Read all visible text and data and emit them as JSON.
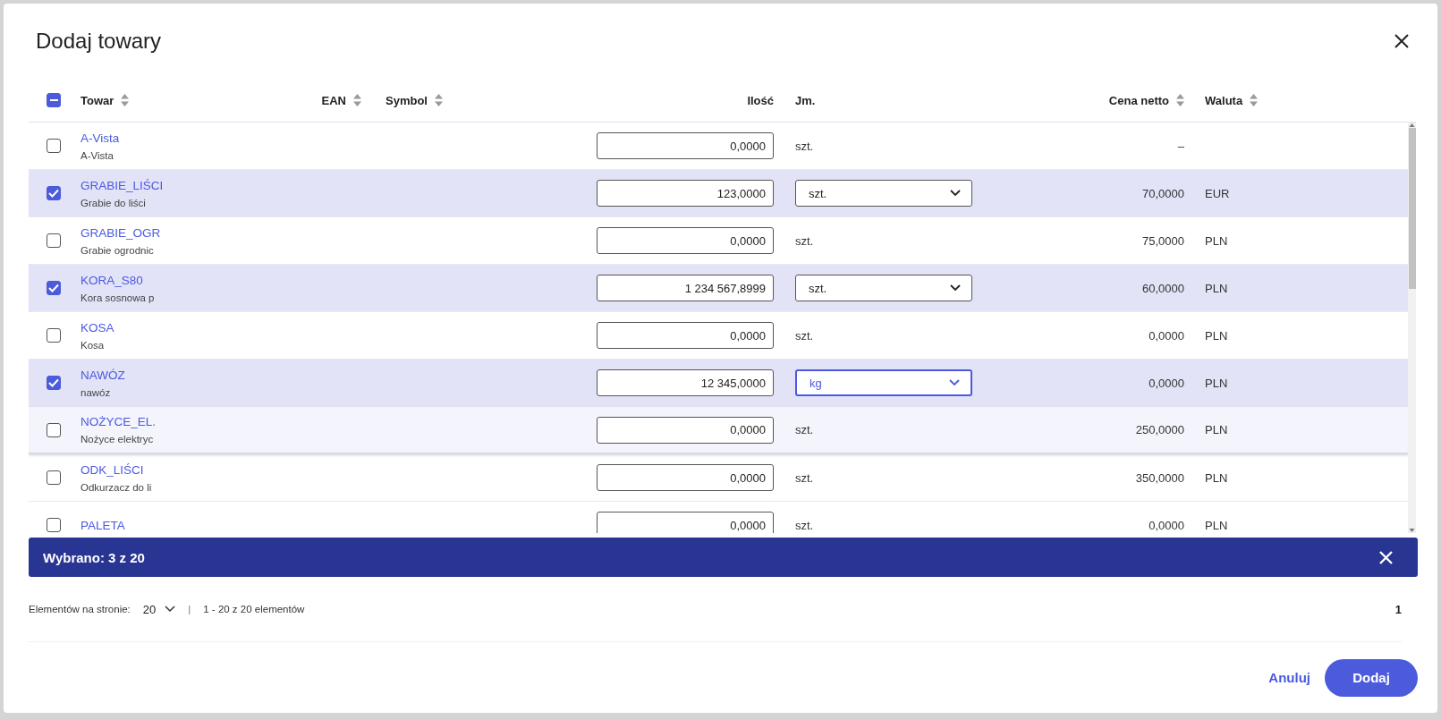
{
  "dialog": {
    "title": "Dodaj towary"
  },
  "table": {
    "select_all": {
      "indeterminate": true
    },
    "columns": [
      {
        "label": "Towar",
        "sortable": true
      },
      {
        "label": "EAN",
        "sortable": true
      },
      {
        "label": "Symbol",
        "sortable": true
      },
      {
        "label": "Ilość",
        "sortable": false
      },
      {
        "label": "Jm.",
        "sortable": false
      },
      {
        "label": "Cena netto",
        "sortable": true
      },
      {
        "label": "Waluta",
        "sortable": true
      }
    ],
    "rows": [
      {
        "name": "A-Vista",
        "description": "A-Vista",
        "selected": false,
        "hovered": false,
        "quantity": "0,0000",
        "unit": {
          "kind": "text",
          "value": "szt."
        },
        "price": "–"
      },
      {
        "name": "GRABIE_LIŚCI",
        "description": "Grabie do liści",
        "selected": true,
        "hovered": false,
        "quantity": "123,0000",
        "unit": {
          "kind": "dropdown",
          "value": "szt.",
          "focused": false
        },
        "price": "70,0000",
        "currency": "EUR"
      },
      {
        "name": "GRABIE_OGR",
        "description": "Grabie ogrodnic",
        "selected": false,
        "hovered": false,
        "quantity": "0,0000",
        "unit": {
          "kind": "text",
          "value": "szt."
        },
        "price": "75,0000",
        "currency": "PLN"
      },
      {
        "name": "KORA_S80",
        "description": "Kora sosnowa p",
        "selected": true,
        "hovered": false,
        "quantity": "1 234 567,8999",
        "unit": {
          "kind": "dropdown",
          "value": "szt.",
          "focused": false
        },
        "price": "60,0000",
        "currency": "PLN"
      },
      {
        "name": "KOSA",
        "description": "Kosa",
        "selected": false,
        "hovered": false,
        "quantity": "0,0000",
        "unit": {
          "kind": "text",
          "value": "szt."
        },
        "price": "0,0000",
        "currency": "PLN"
      },
      {
        "name": "NAWÓZ",
        "description": "nawóz",
        "selected": true,
        "hovered": false,
        "quantity": "12 345,0000",
        "unit": {
          "kind": "dropdown",
          "value": "kg",
          "focused": true
        },
        "price": "0,0000",
        "currency": "PLN"
      },
      {
        "name": "NOŻYCE_EL.",
        "description": "Nożyce elektryc",
        "selected": false,
        "hovered": true,
        "quantity": "0,0000",
        "unit": {
          "kind": "text",
          "value": "szt."
        },
        "price": "250,0000",
        "currency": "PLN"
      },
      {
        "name": "ODK_LIŚCI",
        "description": "Odkurzacz do li",
        "selected": false,
        "hovered": false,
        "quantity": "0,0000",
        "unit": {
          "kind": "text",
          "value": "szt."
        },
        "price": "350,0000",
        "currency": "PLN"
      },
      {
        "name": "PALETA",
        "selected": false,
        "hovered": false,
        "quantity": "0,0000",
        "unit": {
          "kind": "text",
          "value": "szt."
        },
        "price": "0,0000",
        "currency": "PLN"
      }
    ]
  },
  "selection_bar": {
    "text": "Wybrano: 3 z 20"
  },
  "pagination": {
    "page_size_label": "Elementów na stronie:",
    "page_size": "20",
    "separator": "|",
    "range": "1 - 20 z 20 elementów",
    "current_page": "1"
  },
  "buttons": {
    "cancel": "Anuluj",
    "confirm": "Dodaj"
  }
}
